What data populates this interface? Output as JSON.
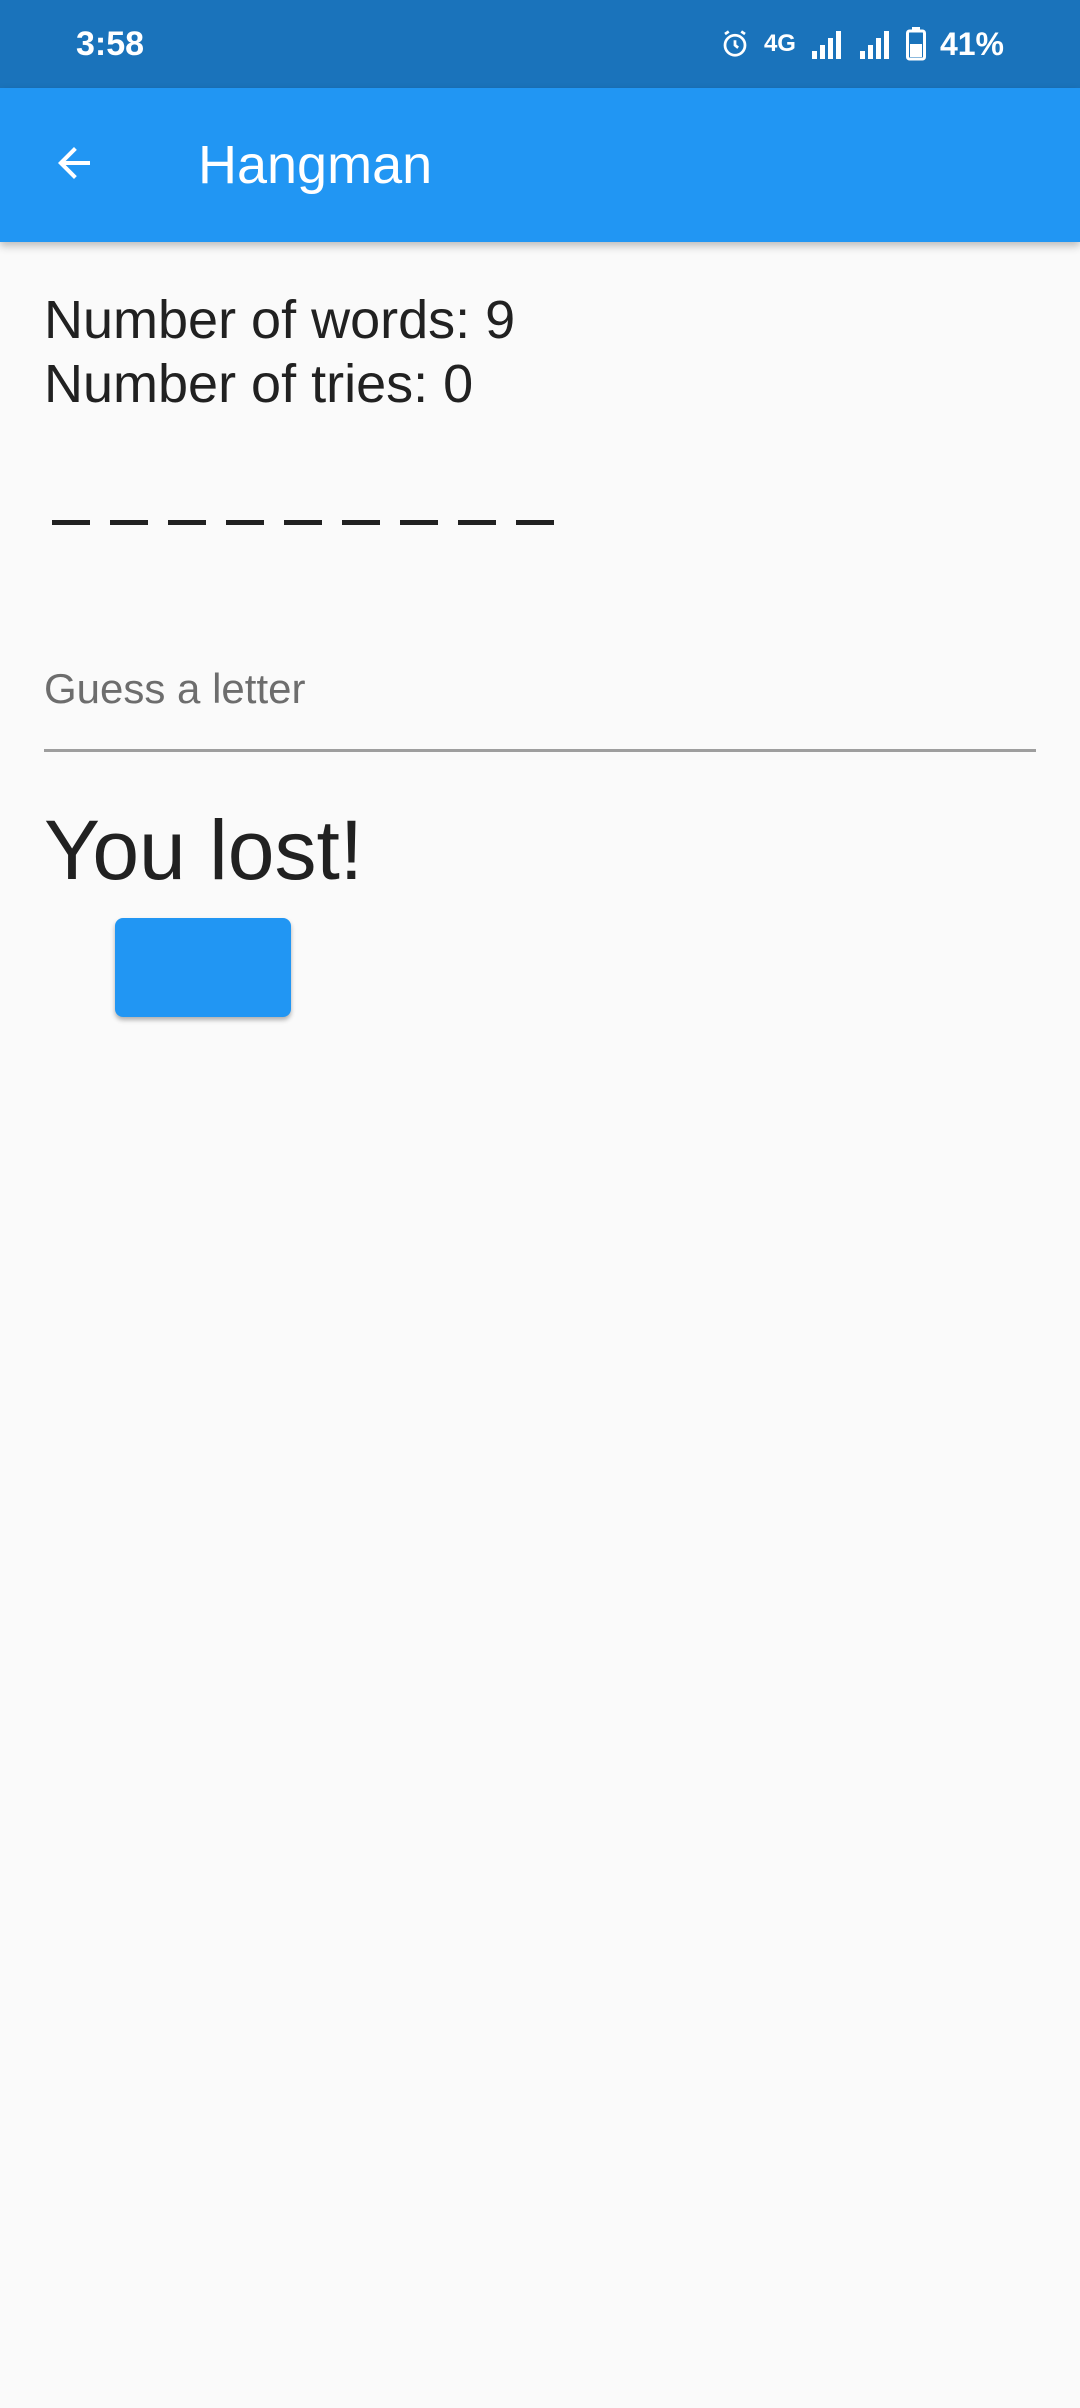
{
  "status_bar": {
    "time": "3:58",
    "network": "4G",
    "battery": "41%",
    "icons": [
      "alarm-icon",
      "signal-icon",
      "signal-icon",
      "battery-icon"
    ]
  },
  "app_bar": {
    "title": "Hangman",
    "back_icon": "arrow-back-icon",
    "color": "#2196f3"
  },
  "game": {
    "words_line": "Number of words: 9",
    "tries_line": "Number of tries: 0",
    "dash_count": 9,
    "guess_placeholder": "Guess a letter",
    "guess_value": "",
    "result": "You lost!",
    "action_button_label": ""
  },
  "colors": {
    "status_bar": "#1a73bb",
    "accent": "#2196f3",
    "background": "#fafafa",
    "text": "#212121"
  }
}
